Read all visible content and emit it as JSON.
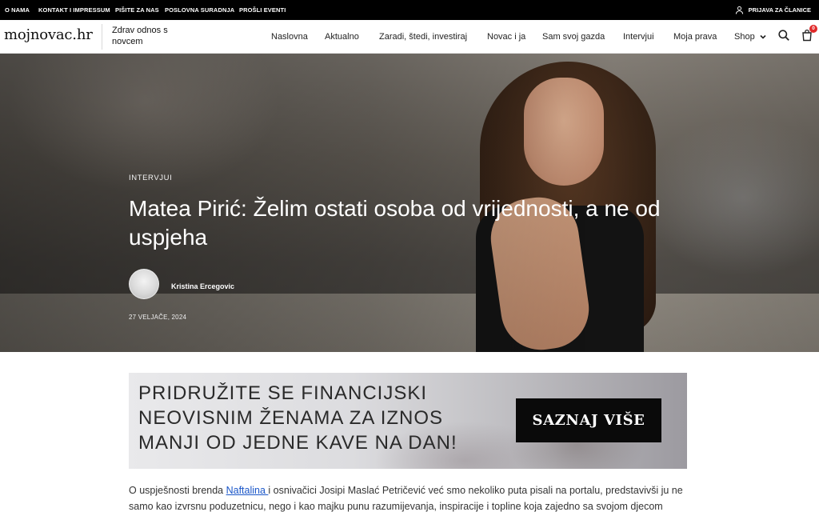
{
  "topbar": {
    "links": [
      "O NAMA",
      "KONTAKT I IMPRESSUM",
      "PIŠITE ZA NAS",
      "POSLOVNA SURADNJA",
      "PROŠLI EVENTI"
    ],
    "login_label": "PRIJAVA ZA ČLANICE"
  },
  "header": {
    "logo": "mojnovac.hr",
    "tagline": "Zdrav odnos s novcem",
    "nav": [
      "Naslovna",
      "Aktualno",
      "Zaradi, štedi, investiraj",
      "Novac i ja",
      "Sam svoj gazda",
      "Intervjui",
      "Moja prava",
      "Shop"
    ],
    "cart_count": "0"
  },
  "hero": {
    "category": "INTERVJUI",
    "title": "Matea Pirić: Želim ostati osoba od vrijednosti, a ne od uspjeha",
    "author": "Kristina Ercegovic",
    "date": "27 VELJAČE, 2024"
  },
  "banner": {
    "text": "PRIDRUŽITE SE FINANCIJSKI NEOVISNIM ŽENAMA ZA IZNOS MANJI OD JEDNE KAVE NA DAN!",
    "button": "SAZNAJ VIŠE"
  },
  "article": {
    "p1_before": "O uspješnosti brenda ",
    "p1_link": "Naftalina ",
    "p1_after": "i osnivačici Josipi Maslać Petričević već smo nekoliko puta pisali na portalu, predstavivši ju ne samo kao izvrsnu poduzetnicu, nego i kao majku punu razumijevanja, inspiracije i topline koja zajedno sa svojom djecom"
  },
  "icons": {
    "user": "user-icon",
    "chevron": "chevron-down-icon",
    "search": "search-icon",
    "cart": "shopping-bag-icon"
  },
  "colors": {
    "topbar_bg": "#000000",
    "badge": "#e02929",
    "link": "#1a56c8",
    "button_bg": "#0a0a0a"
  }
}
